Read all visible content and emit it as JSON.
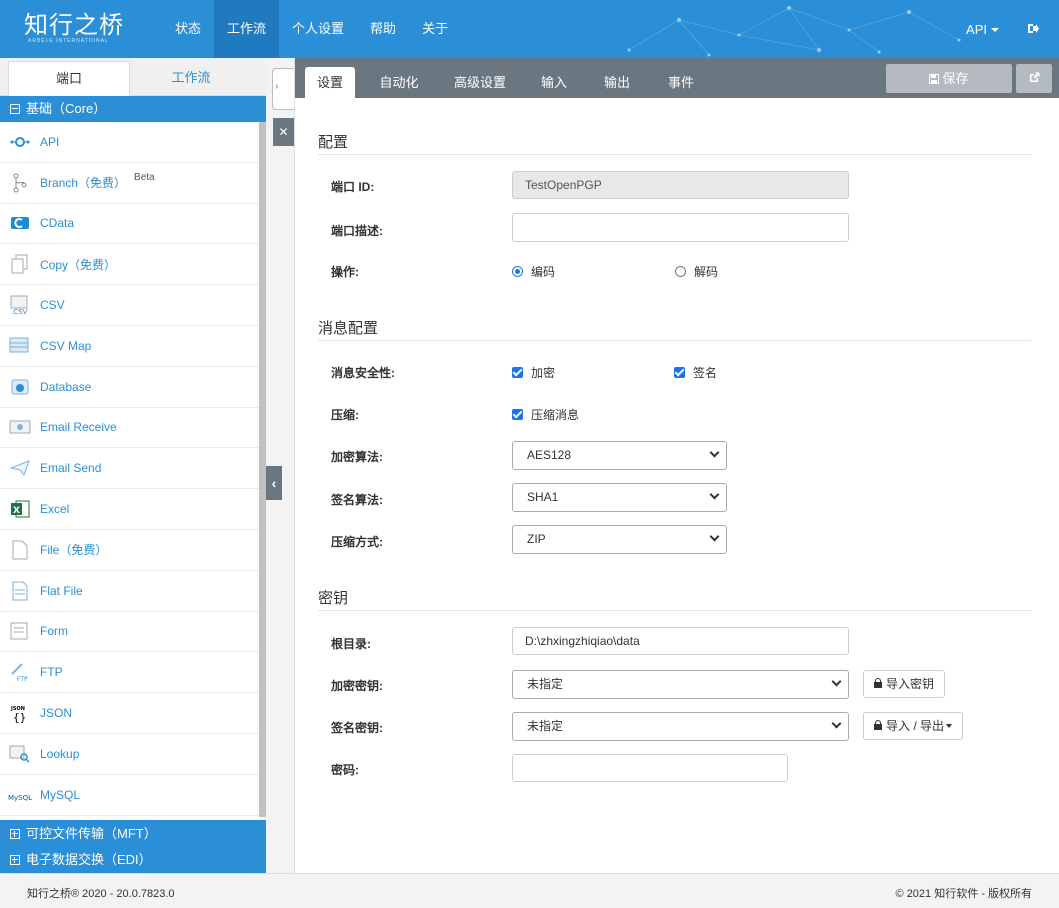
{
  "app": {
    "logo_text": "知行之桥",
    "logo_sub": "ARBELE INTERNATIONAL"
  },
  "nav": {
    "items": [
      {
        "label": "状态"
      },
      {
        "label": "工作流",
        "active": true
      },
      {
        "label": "个人设置"
      },
      {
        "label": "帮助"
      },
      {
        "label": "关于"
      }
    ],
    "api_label": "API",
    "logout_icon": "logout-icon"
  },
  "left_panel": {
    "tabs": [
      {
        "label": "端口",
        "active": true
      },
      {
        "label": "工作流"
      }
    ],
    "groups": {
      "core": "基础（Core）",
      "mft": "可控文件传输（MFT）",
      "edi": "电子数据交换（EDI）"
    },
    "connectors": [
      {
        "label": "API",
        "icon": "api-icon"
      },
      {
        "label": "Branch（免费）",
        "badge": "Beta",
        "icon": "branch-icon"
      },
      {
        "label": "CData",
        "icon": "cdata-icon"
      },
      {
        "label": "Copy（免费）",
        "icon": "copy-icon"
      },
      {
        "label": "CSV",
        "icon": "csv-icon"
      },
      {
        "label": "CSV Map",
        "icon": "csv-map-icon"
      },
      {
        "label": "Database",
        "icon": "database-icon"
      },
      {
        "label": "Email Receive",
        "icon": "email-receive-icon"
      },
      {
        "label": "Email Send",
        "icon": "email-send-icon"
      },
      {
        "label": "Excel",
        "icon": "excel-icon"
      },
      {
        "label": "File（免费）",
        "icon": "file-icon"
      },
      {
        "label": "Flat File",
        "icon": "flat-file-icon"
      },
      {
        "label": "Form",
        "icon": "form-icon"
      },
      {
        "label": "FTP",
        "icon": "ftp-icon"
      },
      {
        "label": "JSON",
        "icon": "json-icon"
      },
      {
        "label": "Lookup",
        "icon": "lookup-icon"
      },
      {
        "label": "MySQL",
        "icon": "mysql-icon"
      }
    ]
  },
  "main": {
    "tabs": [
      {
        "label": "设置",
        "active": true
      },
      {
        "label": "自动化"
      },
      {
        "label": "高级设置"
      },
      {
        "label": "输入"
      },
      {
        "label": "输出"
      },
      {
        "label": "事件"
      }
    ],
    "save_label": "保存",
    "sections": {
      "config": "配置",
      "message": "消息配置",
      "keys": "密钥"
    },
    "fields": {
      "port_id_label": "端口 ID:",
      "port_id_value": "TestOpenPGP",
      "port_desc_label": "端口描述:",
      "port_desc_value": "",
      "operation_label": "操作:",
      "op_encode": "编码",
      "op_decode": "解码",
      "msg_security_label": "消息安全性:",
      "encrypt_label": "加密",
      "sign_label": "签名",
      "compress_label": "压缩:",
      "compress_msg_label": "压缩消息",
      "enc_algo_label": "加密算法:",
      "enc_algo_value": "AES128",
      "sign_algo_label": "签名算法:",
      "sign_algo_value": "SHA1",
      "compress_method_label": "压缩方式:",
      "compress_method_value": "ZIP",
      "root_dir_label": "根目录:",
      "root_dir_value": "D:\\zhxingzhiqiao\\data",
      "enc_key_label": "加密密钥:",
      "enc_key_value": "未指定",
      "import_key_label": "导入密钥",
      "sign_key_label": "签名密钥:",
      "sign_key_value": "未指定",
      "import_export_label": "导入 / 导出",
      "password_label": "密码:",
      "password_value": ""
    }
  },
  "footer": {
    "left": "知行之桥® 2020 - 20.0.7823.0",
    "right": "© 2021 知行软件 - 版权所有"
  }
}
